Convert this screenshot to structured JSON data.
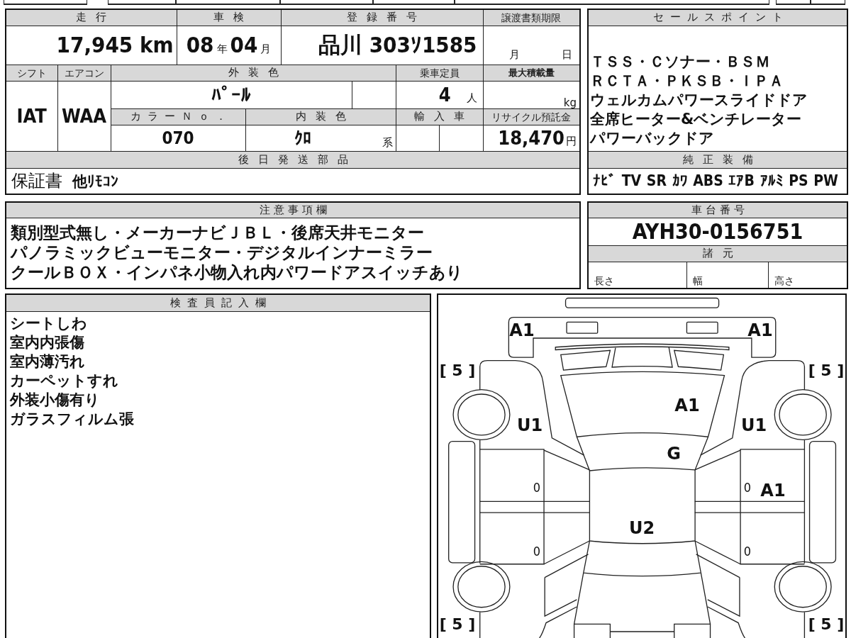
{
  "vehicle_info": {
    "mileage": {
      "label": "走行",
      "value": "17,945 km"
    },
    "inspection": {
      "label": "車検",
      "year": "08",
      "year_unit": "年",
      "month": "04",
      "month_unit": "月"
    },
    "registration": {
      "label": "登録番号",
      "value": "品川 303ｿ1585"
    },
    "transfer_deadline": {
      "label": "譲渡書類期限",
      "month_unit": "月",
      "day_unit": "日"
    },
    "shift": {
      "label": "シフト",
      "value": "IAT"
    },
    "air_conditioner": {
      "label": "エアコン",
      "value": "WAA"
    },
    "exterior_color": {
      "label": "外装色",
      "value": "ﾊﾟｰﾙ"
    },
    "seating_capacity": {
      "label": "乗車定員",
      "value": "4",
      "unit": "人"
    },
    "max_load": {
      "label": "最大積載量",
      "unit": "kg"
    },
    "color_number": {
      "label": "カラーＮｏ．",
      "value": "070"
    },
    "interior_color": {
      "label": "内装色",
      "value": "ｸﾛ",
      "suffix": "系"
    },
    "imported": {
      "label": "輸入車"
    },
    "recycling_deposit": {
      "label": "リサイクル預託金",
      "value": "18,470",
      "unit": "円"
    }
  },
  "parts_sent_later": {
    "label": "後日発送部品",
    "items": [
      "保証書",
      "他ﾘﾓｺﾝ"
    ]
  },
  "sales_points": {
    "label": "セールスポイント",
    "lines": [
      "ＴＳＳ・Ｃソナー・ＢＳＭ",
      "ＲＣＴＡ・ＰＫＳＢ・ＩＰＡ",
      "ウェルカムパワースライドドア",
      "全席ヒーター&ベンチレーター",
      "パワーバックドア"
    ]
  },
  "standard_equipment": {
    "label": "純正装備",
    "items": [
      "ﾅﾋﾞ",
      "TV",
      "SR",
      "ｶﾜ",
      "ABS",
      "ｴｱB",
      "ｱﾙﾐ",
      "PS",
      "PW"
    ]
  },
  "notes": {
    "label": "注意事項欄",
    "lines": [
      "類別型式無し・メーカーナビＪＢＬ・後席天井モニター",
      "パノラミックビューモニター・デジタルインナーミラー",
      "クールＢＯＸ・インパネ小物入れ内パワードアスイッチあり"
    ]
  },
  "chassis_number": {
    "label": "車台番号",
    "value": "AYH30-0156751"
  },
  "specifications": {
    "label": "諸元",
    "fields": [
      "長さ",
      "幅",
      "高さ"
    ]
  },
  "inspector_notes": {
    "label": "検査員記入欄",
    "lines": [
      "シートしわ",
      "室内内張傷",
      "室内薄汚れ",
      "カーペットすれ",
      "外装小傷有り",
      "ガラスフィルム張"
    ]
  },
  "damage_diagram": {
    "marks": {
      "front_bumper_left": {
        "kind": "code",
        "text": "A1"
      },
      "front_bumper_right": {
        "kind": "code",
        "text": "A1"
      },
      "front_left_tire": {
        "kind": "bracket",
        "text": "[ 5 ]"
      },
      "front_right_tire": {
        "kind": "bracket",
        "text": "[ 5 ]"
      },
      "hood": {
        "kind": "code",
        "text": "A1"
      },
      "left_front_fender": {
        "kind": "code",
        "text": "U1"
      },
      "right_front_fender": {
        "kind": "code",
        "text": "U1"
      },
      "windshield": {
        "kind": "code",
        "text": "G"
      },
      "left_front_door_inner": {
        "kind": "small",
        "text": "0"
      },
      "right_front_door_inner": {
        "kind": "small",
        "text": "0"
      },
      "right_front_door": {
        "kind": "code",
        "text": "A1"
      },
      "roof": {
        "kind": "code",
        "text": "U2"
      },
      "left_rear_door_inner": {
        "kind": "small",
        "text": "0"
      },
      "right_rear_door_inner": {
        "kind": "small",
        "text": "0"
      },
      "rear_left_tire": {
        "kind": "bracket",
        "text": "[ 5 ]"
      },
      "rear_right_tire": {
        "kind": "bracket",
        "text": "[ 5 ]"
      }
    }
  }
}
